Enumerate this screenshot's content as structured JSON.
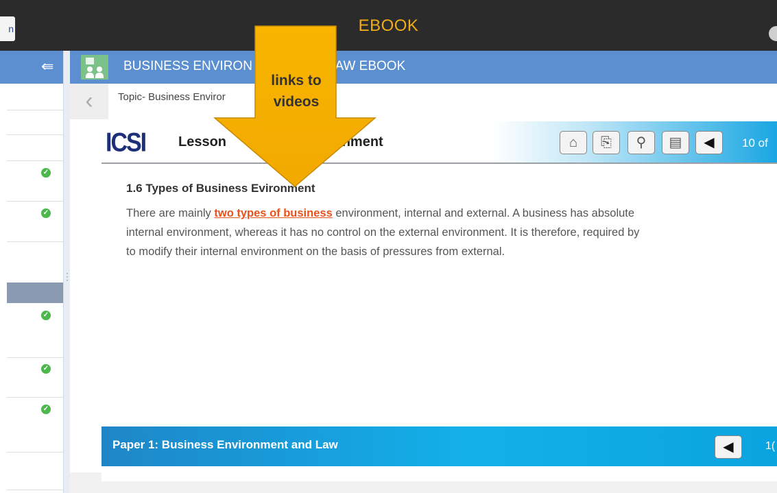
{
  "app": {
    "title": "EBOOK",
    "left_tab_glyph": "n"
  },
  "sidebar": {
    "collapse_icon": "⇚",
    "check_glyph": "✓"
  },
  "book": {
    "title": "BUSINESS ENVIRON",
    "title_tail": "LAW EBOOK"
  },
  "topic": {
    "back_glyph": "‹",
    "label": "Topic- Business Enviror"
  },
  "lesson": {
    "logo_text": "ICSI",
    "title_start": "Lesson",
    "title_end": "vironment",
    "toolbar_icons": [
      "briefcase-icon",
      "notes-icon",
      "search-icon",
      "edit-icon",
      "previous-icon"
    ],
    "toolbar_glyphs": [
      "⌂",
      "⎘",
      "⚲",
      "▤",
      "◀"
    ],
    "page_count": "10 of"
  },
  "section": {
    "title_start": "1.6 Types of Business E",
    "title_end": "vironment"
  },
  "paragraph": {
    "line1_before": "There are mainly ",
    "link_text": "two types of business",
    "line1_after": " environment, internal and external. A business has absolute",
    "line2": "internal environment, whereas it has no control on the external environment. It is therefore, required by",
    "line3": "to modify their internal environment on the basis of pressures from external."
  },
  "footer": {
    "paper_label": "Paper 1: Business Environment and Law",
    "prev_glyph": "◀",
    "page_count": "1("
  },
  "annotation": {
    "line1": "links to",
    "line2": "videos",
    "arrow_color": "#f7b500"
  },
  "colors": {
    "topbar": "#2b2b2b",
    "title_orange": "#f0ad1a",
    "header_blue": "#5b8fd0",
    "link_orange": "#e8531d",
    "check_green": "#4cb84c"
  }
}
